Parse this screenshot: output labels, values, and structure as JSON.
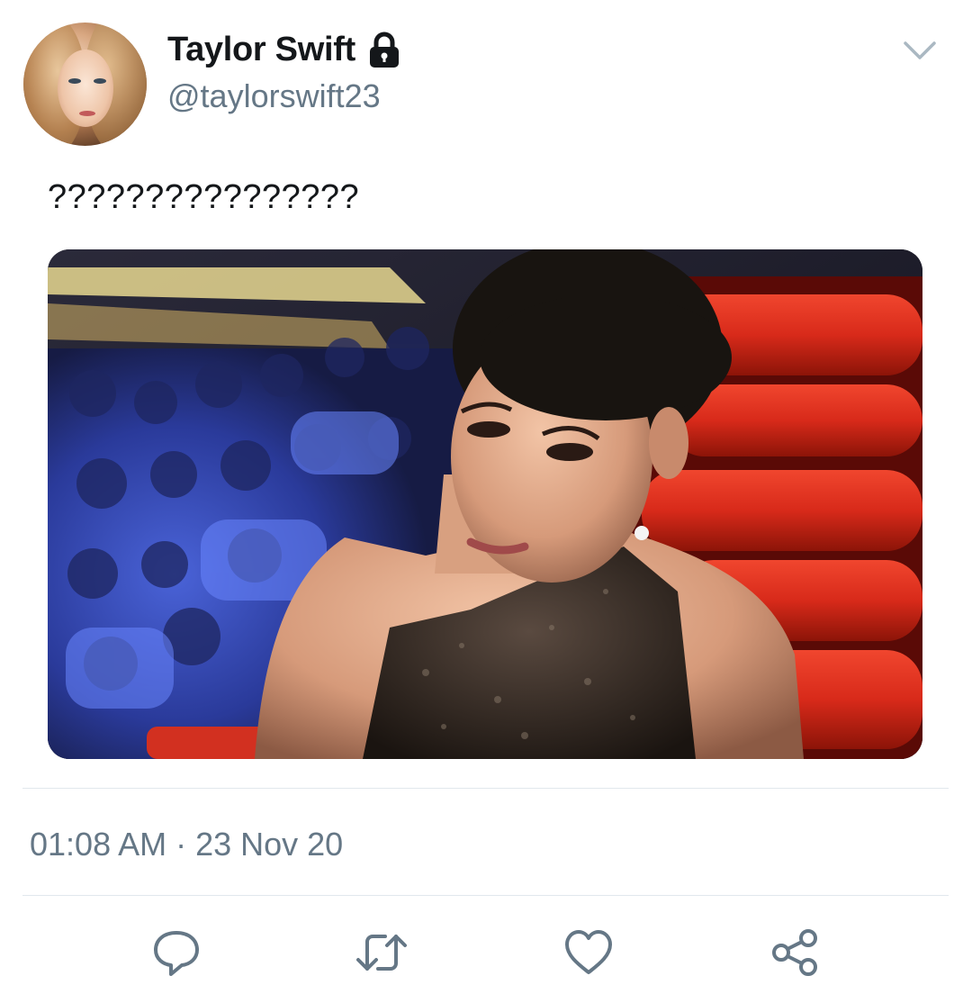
{
  "tweet": {
    "author": {
      "display_name": "Taylor Swift",
      "handle": "@taylorswift23",
      "protected_icon": "lock-icon"
    },
    "menu_icon": "chevron-down-icon",
    "text": "????????????????",
    "timestamp": "01:08 AM · 23 Nov 20"
  },
  "actions": [
    {
      "icon": "reply-icon"
    },
    {
      "icon": "retweet-icon"
    },
    {
      "icon": "like-icon"
    },
    {
      "icon": "share-icon"
    }
  ],
  "colors": {
    "text_primary": "#14171a",
    "text_secondary": "#657786",
    "divider": "#e1e8ed",
    "icon": "#657786"
  }
}
